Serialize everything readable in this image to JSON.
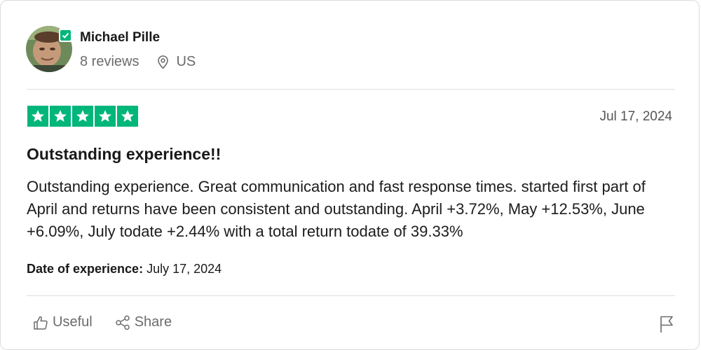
{
  "reviewer": {
    "name": "Michael Pille",
    "reviews_count": "8 reviews",
    "location": "US",
    "verified_icon": "check-icon",
    "location_icon": "location-pin-icon"
  },
  "review": {
    "rating": 5,
    "rating_max": 5,
    "date": "Jul 17, 2024",
    "title": "Outstanding experience!!",
    "body": "Outstanding experience. Great communication and fast response times. started first part of April and returns have been consistent and outstanding. April +3.72%, May +12.53%, June +6.09%, July todate +2.44% with a total return todate of 39.33%",
    "experience_label": "Date of experience:",
    "experience_date": "July 17, 2024"
  },
  "actions": {
    "useful_label": "Useful",
    "share_label": "Share",
    "useful_icon": "thumbs-up-icon",
    "share_icon": "share-icon",
    "flag_icon": "flag-icon"
  },
  "colors": {
    "star_green": "#00b67a",
    "muted_text": "#6b6b6b"
  }
}
